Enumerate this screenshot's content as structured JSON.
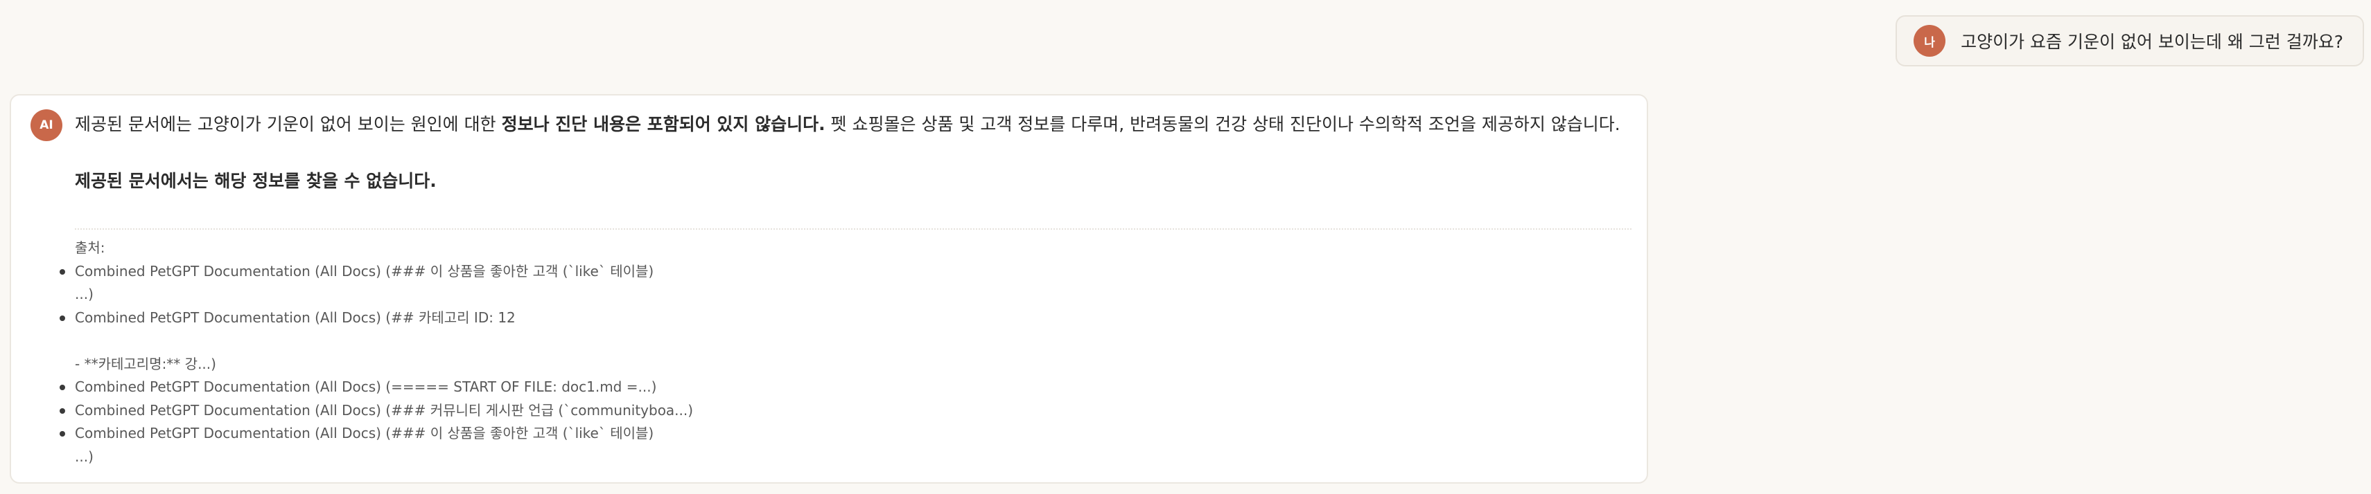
{
  "user_message": {
    "avatar_label": "나",
    "text": "고양이가 요즘 기운이 없어 보이는데 왜 그런 걸까요?"
  },
  "assistant_message": {
    "avatar_label": "AI",
    "answer_prefix": "제공된 문서에는 고양이가 기운이 없어 보이는 원인에 대한 ",
    "answer_bold": "정보나 진단 내용은 포함되어 있지 않습니다.",
    "answer_suffix": " 펫 쇼핑몰은 상품 및 고객 정보를 다루며, 반려동물의 건강 상태 진단이나 수의학적 조언을 제공하지 않습니다.",
    "conclusion": "제공된 문서에서는 해당 정보를 찾을 수 없습니다.",
    "sources_title": "출처:",
    "sources": [
      "Combined PetGPT Documentation (All Docs) (### 이 상품을 좋아한 고객 (`like` 테이블)\n...)",
      "Combined PetGPT Documentation (All Docs) (## 카테고리 ID: 12\n\n- **카테고리명:** 강...)",
      "Combined PetGPT Documentation (All Docs) (===== START OF FILE: doc1.md =...)",
      "Combined PetGPT Documentation (All Docs) (### 커뮤니티 게시판 언급 (`communityboa...)",
      "Combined PetGPT Documentation (All Docs) (### 이 상품을 좋아한 고객 (`like` 테이블)\n...)"
    ]
  },
  "colors": {
    "page_background": "#faf8f4",
    "avatar_accent": "#c9684a",
    "card_background": "#ffffff",
    "user_bubble_background": "#f7f4ef"
  }
}
